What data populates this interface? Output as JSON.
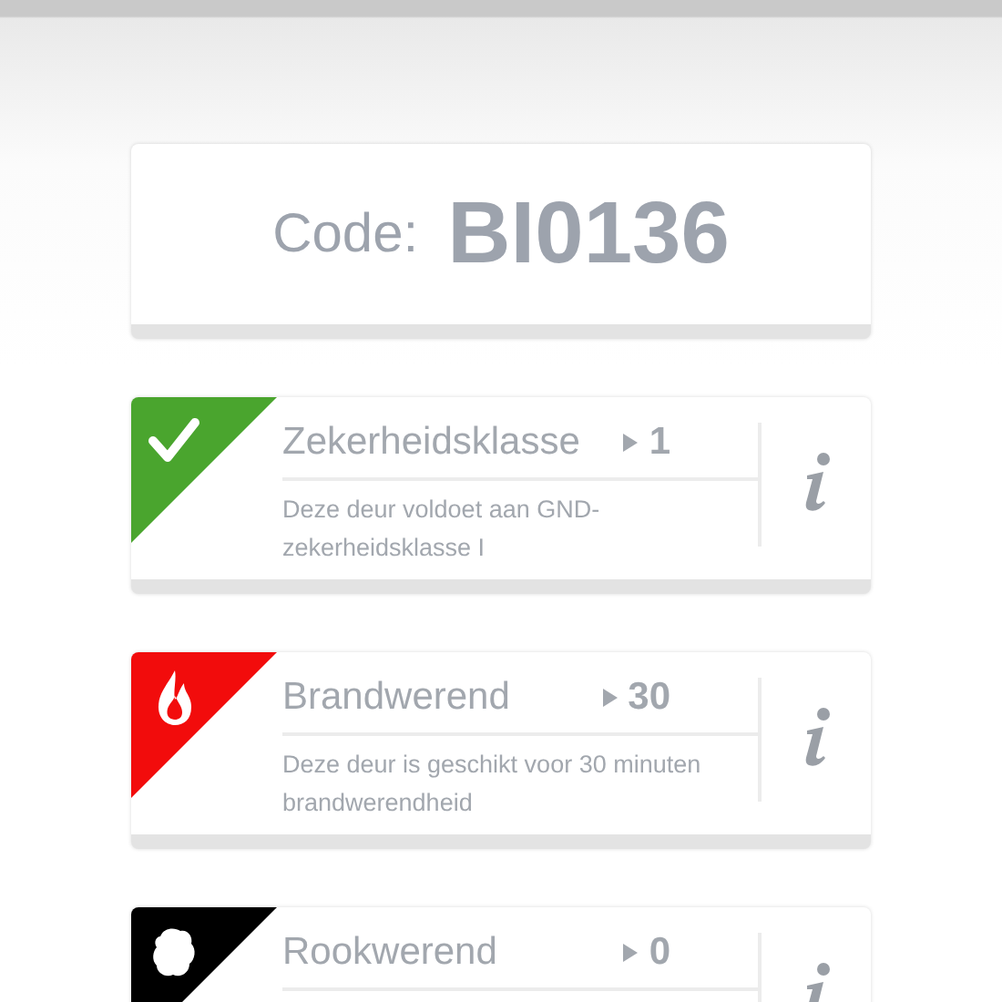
{
  "code": {
    "label": "Code:",
    "value": "BI0136"
  },
  "features": [
    {
      "kind": "check",
      "color": "#4aa52e",
      "title": "Zekerheidsklasse",
      "value": "1",
      "description": "Deze deur voldoet aan GND-zekerheidsklasse I"
    },
    {
      "kind": "fire",
      "color": "#f20c0c",
      "title": "Brandwerend",
      "value": "30",
      "description": "Deze deur is geschikt voor 30 minuten brandwerendheid"
    },
    {
      "kind": "smoke",
      "color": "#000000",
      "title": "Rookwerend",
      "value": "0"
    }
  ]
}
